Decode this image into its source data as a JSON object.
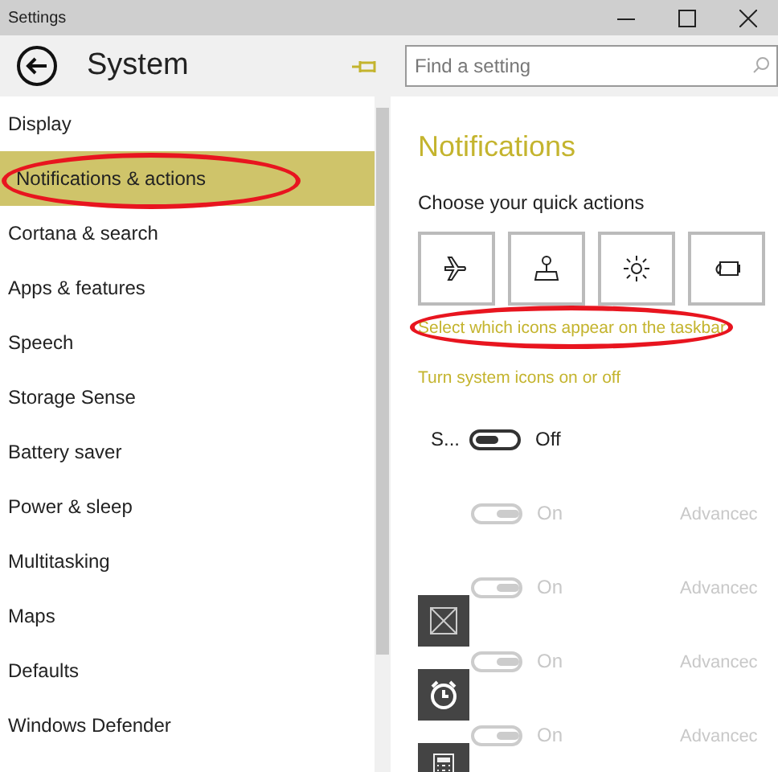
{
  "window": {
    "title": "Settings"
  },
  "header": {
    "title": "System",
    "search": {
      "placeholder": "Find a setting"
    }
  },
  "sidebar": {
    "items": [
      {
        "label": "Display",
        "selected": false,
        "circled": false
      },
      {
        "label": "Notifications & actions",
        "selected": true,
        "circled": true
      },
      {
        "label": "Cortana & search",
        "selected": false,
        "circled": false
      },
      {
        "label": "Apps & features",
        "selected": false,
        "circled": false
      },
      {
        "label": "Speech",
        "selected": false,
        "circled": false
      },
      {
        "label": "Storage Sense",
        "selected": false,
        "circled": false
      },
      {
        "label": "Battery saver",
        "selected": false,
        "circled": false
      },
      {
        "label": "Power & sleep",
        "selected": false,
        "circled": false
      },
      {
        "label": "Multitasking",
        "selected": false,
        "circled": false
      },
      {
        "label": "Maps",
        "selected": false,
        "circled": false
      },
      {
        "label": "Defaults",
        "selected": false,
        "circled": false
      },
      {
        "label": "Windows Defender",
        "selected": false,
        "circled": false
      }
    ]
  },
  "content": {
    "title": "Notifications",
    "quick_actions_label": "Choose your quick actions",
    "quick_actions": [
      {
        "kind": "airplane"
      },
      {
        "kind": "location"
      },
      {
        "kind": "brightness"
      },
      {
        "kind": "battery"
      }
    ],
    "links": [
      {
        "text": "Select which icons appear on the taskbar",
        "circled": true
      },
      {
        "text": "Turn system icons on or off",
        "circled": false
      }
    ],
    "system_icons": [
      {
        "kind": "label",
        "label": "S...",
        "on": false,
        "disabled": false,
        "state_text": "Off"
      },
      {
        "kind": "none",
        "on": true,
        "disabled": true,
        "state_text": "On",
        "link": "Advancec"
      },
      {
        "kind": "crossed-box",
        "on": true,
        "disabled": true,
        "state_text": "On",
        "link": "Advancec"
      },
      {
        "kind": "alarm",
        "on": true,
        "disabled": true,
        "state_text": "On",
        "link": "Advancec"
      },
      {
        "kind": "calculator",
        "on": true,
        "disabled": true,
        "state_text": "On",
        "link": "Advancec"
      }
    ]
  }
}
